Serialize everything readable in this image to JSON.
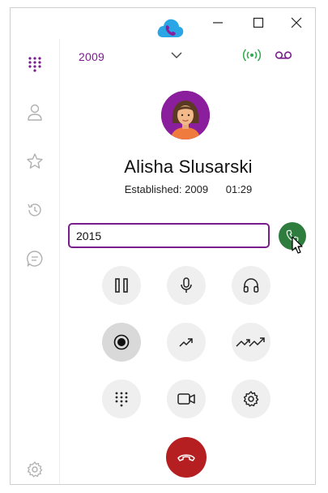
{
  "window": {
    "controls": {
      "minimize": "minimize-icon",
      "maximize": "maximize-icon",
      "close": "close-icon"
    }
  },
  "sidebar": {
    "items": [
      {
        "name": "dialpad",
        "icon": "dialpad-icon",
        "active": true
      },
      {
        "name": "contacts",
        "icon": "person-icon",
        "active": false
      },
      {
        "name": "favorites",
        "icon": "star-icon",
        "active": false
      },
      {
        "name": "history",
        "icon": "history-icon",
        "active": false
      },
      {
        "name": "chat",
        "icon": "chat-icon",
        "active": false
      }
    ],
    "settings_icon": "gear-icon"
  },
  "header": {
    "line": "2009",
    "registration_icon": "signal-icon",
    "voicemail_icon": "voicemail-icon"
  },
  "call": {
    "name": "Alisha Slusarski",
    "status": "Established: 2009",
    "duration": "01:29"
  },
  "dial": {
    "value": "2015"
  },
  "controls": [
    {
      "name": "hold",
      "icon": "pause-icon",
      "active": false
    },
    {
      "name": "mute",
      "icon": "microphone-icon",
      "active": false
    },
    {
      "name": "audio-device",
      "icon": "headphones-icon",
      "active": false
    },
    {
      "name": "record",
      "icon": "record-icon",
      "active": true
    },
    {
      "name": "transfer",
      "icon": "transfer-arrow-icon",
      "active": false
    },
    {
      "name": "attended-transfer",
      "icon": "double-arrow-icon",
      "active": false
    },
    {
      "name": "keypad",
      "icon": "dialpad-icon",
      "active": false
    },
    {
      "name": "video",
      "icon": "video-camera-icon",
      "active": false
    },
    {
      "name": "settings",
      "icon": "gear-icon",
      "active": false
    }
  ],
  "colors": {
    "accent": "#7a1d8c",
    "call_green": "#2e7d3e",
    "hangup_red": "#b51f22",
    "signal_green": "#2fa84f",
    "control_bg": "#efefef",
    "control_active_bg": "#d9d9d9"
  }
}
